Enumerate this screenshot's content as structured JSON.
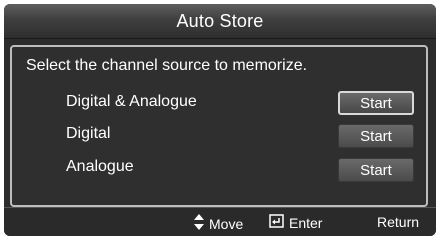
{
  "window": {
    "title": "Auto Store"
  },
  "prompt": "Select the channel source to memorize.",
  "rows": [
    {
      "label": "Digital & Analogue",
      "button": "Start",
      "selected": true
    },
    {
      "label": "Digital",
      "button": "Start",
      "selected": false
    },
    {
      "label": "Analogue",
      "button": "Start",
      "selected": false
    }
  ],
  "footer": {
    "move": {
      "icon": "up-down-arrows-icon",
      "label": "Move"
    },
    "enter": {
      "icon": "enter-icon",
      "label": "Enter"
    },
    "return": {
      "label": "Return"
    }
  }
}
